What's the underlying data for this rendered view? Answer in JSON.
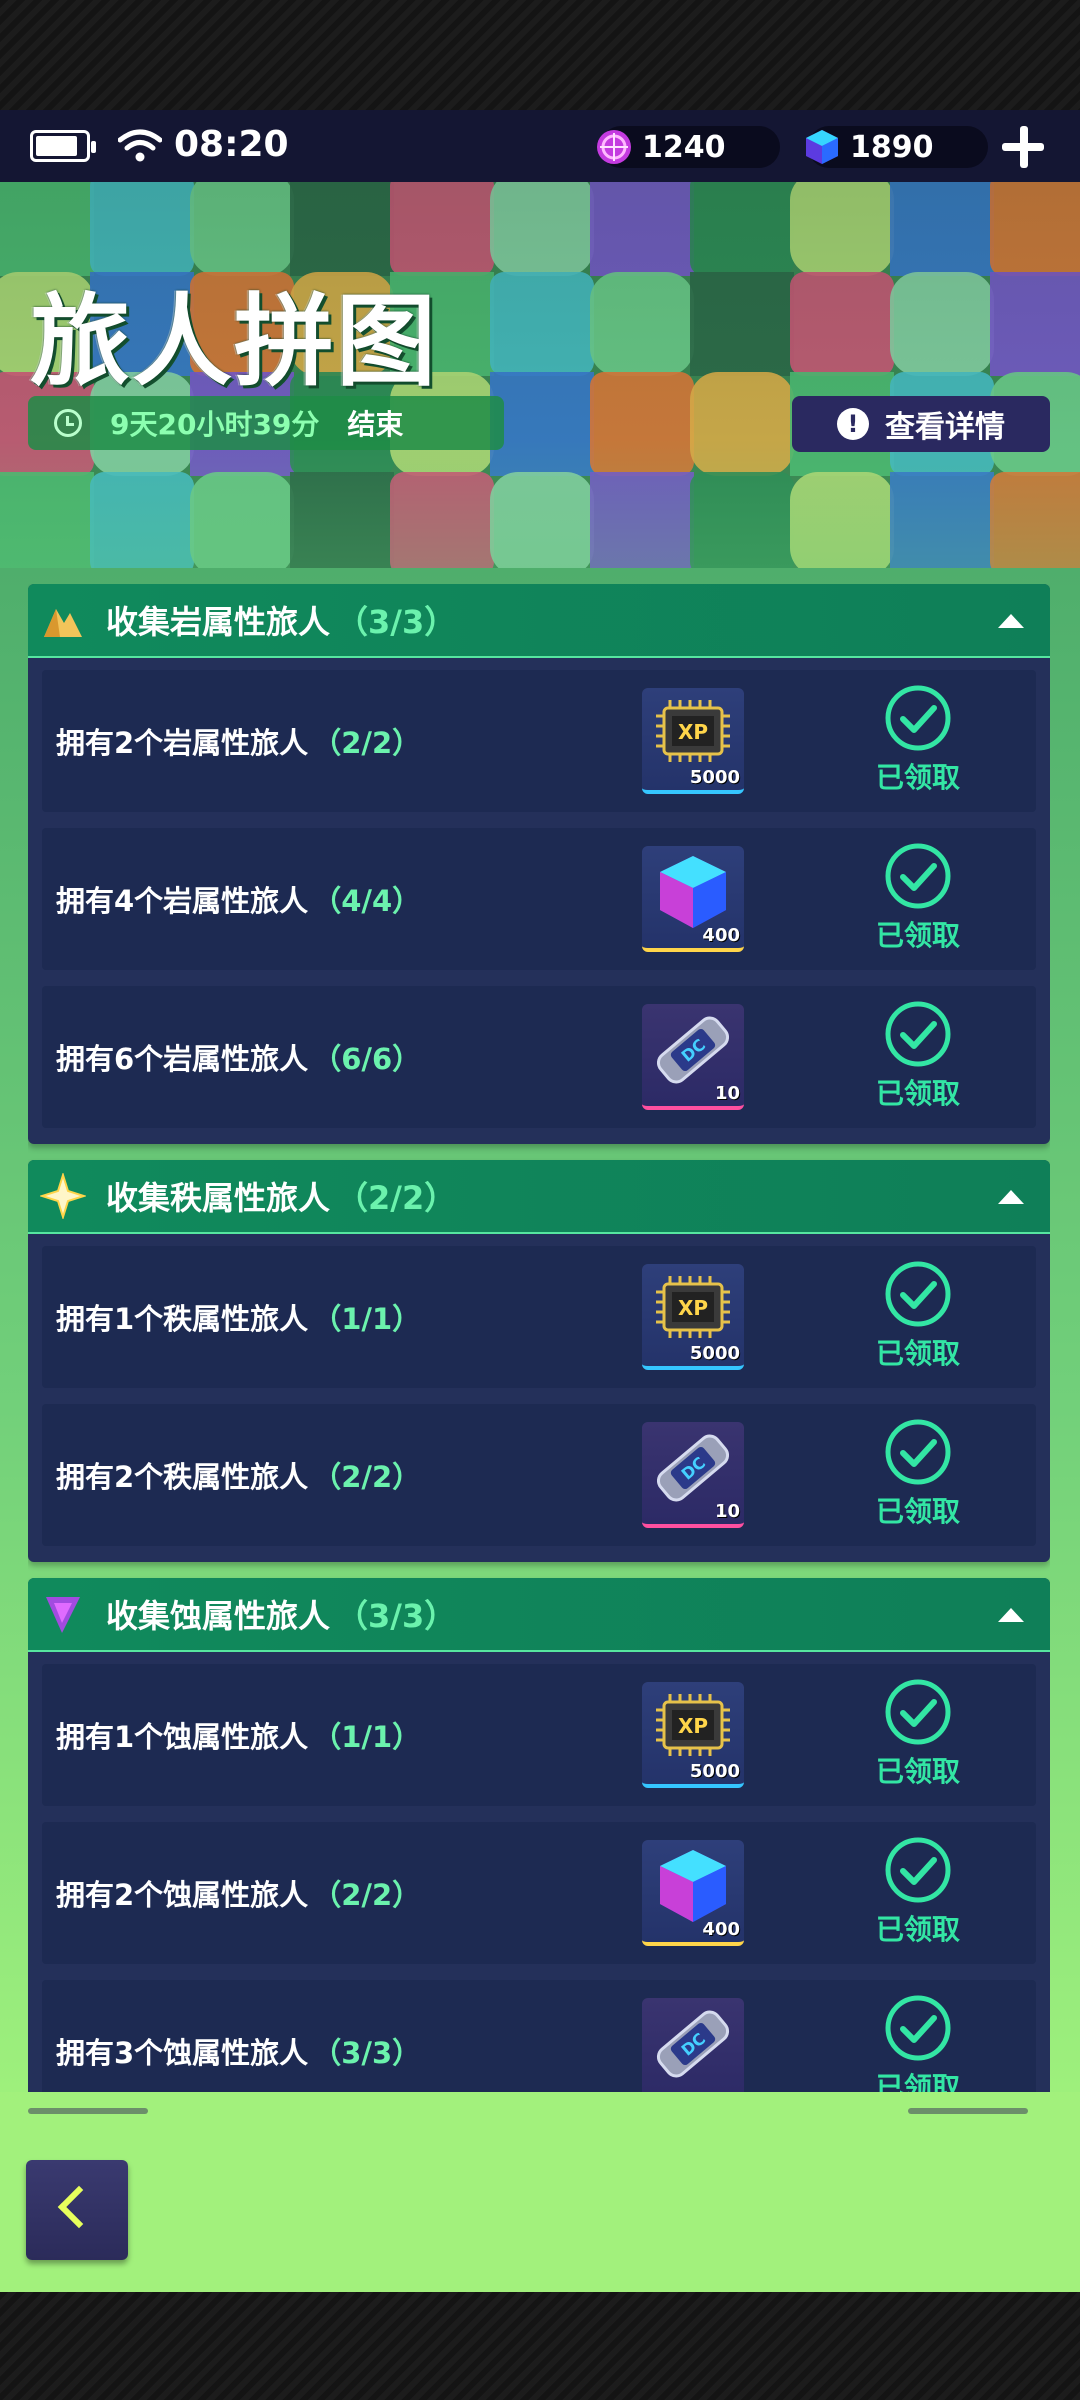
{
  "status": {
    "time": "08:20",
    "battery_level": 0.85,
    "currency1_value": "1240",
    "currency1_icon": "purple-orb-icon",
    "currency2_value": "1890",
    "currency2_icon": "blue-cube-icon"
  },
  "header": {
    "title": "旅人拼图",
    "timer": "9天20小时39分",
    "timer_suffix": "结束",
    "detail_label": "查看详情"
  },
  "sections": [
    {
      "title": "收集岩属性旅人",
      "progress": "（3/3）",
      "icon": "rock-element-icon",
      "tasks": [
        {
          "label": "拥有2个岩属性旅人",
          "progress": "（2/2）",
          "reward": "xp-chip",
          "qty": "5000",
          "status": "已领取"
        },
        {
          "label": "拥有4个岩属性旅人",
          "progress": "（4/4）",
          "reward": "cube",
          "qty": "400",
          "status": "已领取"
        },
        {
          "label": "拥有6个岩属性旅人",
          "progress": "（6/6）",
          "reward": "ticket",
          "qty": "10",
          "status": "已领取"
        }
      ]
    },
    {
      "title": "收集秩属性旅人",
      "progress": "（2/2）",
      "icon": "order-element-icon",
      "tasks": [
        {
          "label": "拥有1个秩属性旅人",
          "progress": "（1/1）",
          "reward": "xp-chip",
          "qty": "5000",
          "status": "已领取"
        },
        {
          "label": "拥有2个秩属性旅人",
          "progress": "（2/2）",
          "reward": "ticket",
          "qty": "10",
          "status": "已领取"
        }
      ]
    },
    {
      "title": "收集蚀属性旅人",
      "progress": "（3/3）",
      "icon": "erosion-element-icon",
      "tasks": [
        {
          "label": "拥有1个蚀属性旅人",
          "progress": "（1/1）",
          "reward": "xp-chip",
          "qty": "5000",
          "status": "已领取"
        },
        {
          "label": "拥有2个蚀属性旅人",
          "progress": "（2/2）",
          "reward": "cube",
          "qty": "400",
          "status": "已领取"
        },
        {
          "label": "拥有3个蚀属性旅人",
          "progress": "（3/3）",
          "reward": "ticket",
          "qty": "",
          "status": "已领取"
        }
      ]
    }
  ],
  "colors": {
    "accent_green": "#6bf2ad",
    "section_header": "#108a5c",
    "panel": "#24305a",
    "claimed_text": "#33e6a4"
  }
}
